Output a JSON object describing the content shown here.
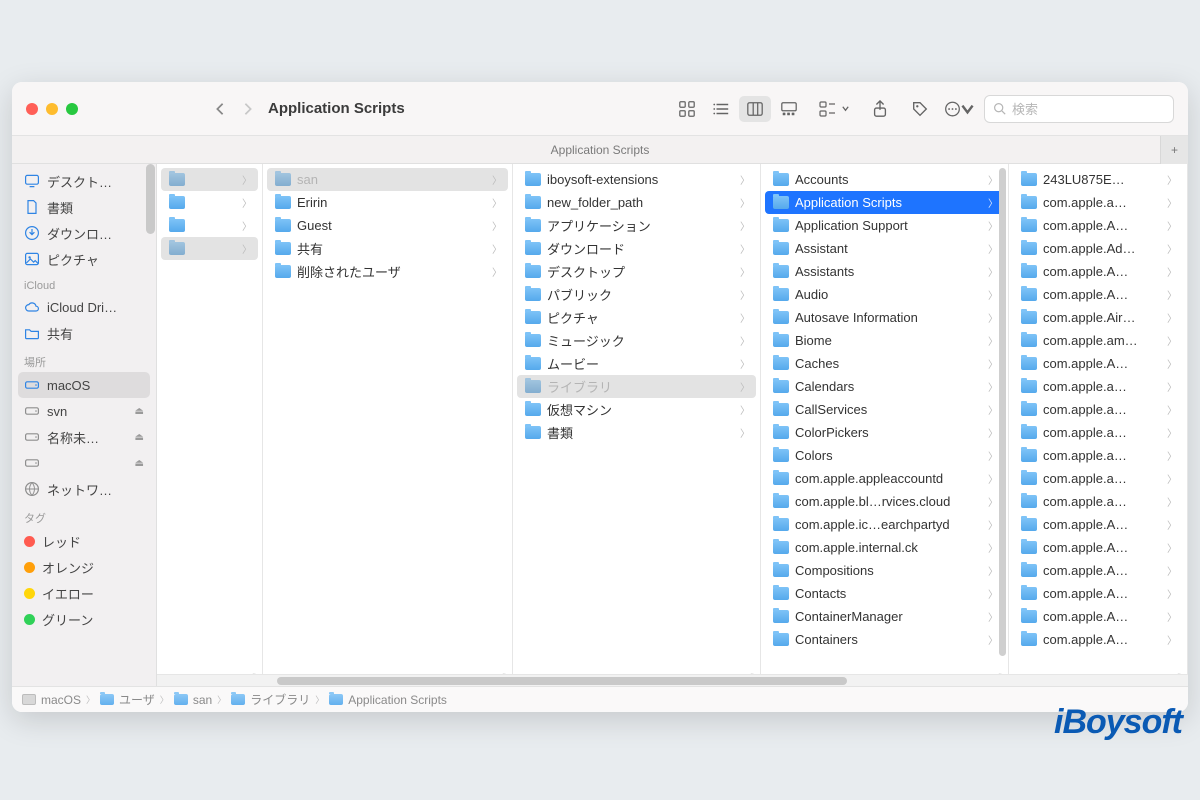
{
  "window": {
    "title": "Application Scripts",
    "tab_label": "Application Scripts"
  },
  "search": {
    "placeholder": "検索"
  },
  "sidebar": {
    "favorites": [
      {
        "icon": "desktop",
        "label": "デスクト…"
      },
      {
        "icon": "doc",
        "label": "書類"
      },
      {
        "icon": "download",
        "label": "ダウンロ…"
      },
      {
        "icon": "picture",
        "label": "ピクチャ"
      }
    ],
    "icloud_header": "iCloud",
    "icloud": [
      {
        "icon": "cloud",
        "label": "iCloud Dri…"
      },
      {
        "icon": "sharefolder",
        "label": "共有"
      }
    ],
    "locations_header": "場所",
    "locations": [
      {
        "icon": "drive",
        "label": "macOS",
        "selected": true
      },
      {
        "icon": "drive",
        "label": "svn",
        "eject": true,
        "gray": true
      },
      {
        "icon": "drive",
        "label": "名称未…",
        "eject": true,
        "gray": true
      },
      {
        "icon": "drive",
        "label": "",
        "eject": true,
        "gray": true
      },
      {
        "icon": "globe",
        "label": "ネットワ…",
        "gray": true
      }
    ],
    "tags_header": "タグ",
    "tags": [
      {
        "color": "#ff5b50",
        "label": "レッド"
      },
      {
        "color": "#ff9f0a",
        "label": "オレンジ"
      },
      {
        "color": "#ffd60a",
        "label": "イエロー"
      },
      {
        "color": "#30d158",
        "label": "グリーン"
      }
    ]
  },
  "columns": [
    {
      "items": [
        {
          "label": "",
          "sel": "gray"
        },
        {
          "label": ""
        },
        {
          "label": ""
        },
        {
          "label": "",
          "sel": "gray"
        }
      ]
    },
    {
      "items": [
        {
          "label": "san",
          "sel": "gray",
          "dim": true
        },
        {
          "label": "Eririn"
        },
        {
          "label": "Guest"
        },
        {
          "label": "共有"
        },
        {
          "label": "削除されたユーザ"
        }
      ]
    },
    {
      "items": [
        {
          "label": "iboysoft-extensions"
        },
        {
          "label": "new_folder_path"
        },
        {
          "label": "アプリケーション"
        },
        {
          "label": "ダウンロード"
        },
        {
          "label": "デスクトップ"
        },
        {
          "label": "パブリック"
        },
        {
          "label": "ピクチャ"
        },
        {
          "label": "ミュージック"
        },
        {
          "label": "ムービー"
        },
        {
          "label": "ライブラリ",
          "sel": "gray",
          "dim": true
        },
        {
          "label": "仮想マシン"
        },
        {
          "label": "書類"
        }
      ]
    },
    {
      "items": [
        {
          "label": "Accounts"
        },
        {
          "label": "Application Scripts",
          "sel": "blue"
        },
        {
          "label": "Application Support"
        },
        {
          "label": "Assistant"
        },
        {
          "label": "Assistants"
        },
        {
          "label": "Audio"
        },
        {
          "label": "Autosave Information"
        },
        {
          "label": "Biome"
        },
        {
          "label": "Caches"
        },
        {
          "label": "Calendars"
        },
        {
          "label": "CallServices"
        },
        {
          "label": "ColorPickers"
        },
        {
          "label": "Colors"
        },
        {
          "label": "com.apple.appleaccountd"
        },
        {
          "label": "com.apple.bl…rvices.cloud"
        },
        {
          "label": "com.apple.ic…earchpartyd"
        },
        {
          "label": "com.apple.internal.ck"
        },
        {
          "label": "Compositions"
        },
        {
          "label": "Contacts"
        },
        {
          "label": "ContainerManager"
        },
        {
          "label": "Containers"
        }
      ],
      "scroll": true
    },
    {
      "items": [
        {
          "label": "243LU875E…"
        },
        {
          "label": "com.apple.a…"
        },
        {
          "label": "com.apple.A…"
        },
        {
          "label": "com.apple.Ad…"
        },
        {
          "label": "com.apple.A…"
        },
        {
          "label": "com.apple.A…"
        },
        {
          "label": "com.apple.Air…"
        },
        {
          "label": "com.apple.am…"
        },
        {
          "label": "com.apple.A…"
        },
        {
          "label": "com.apple.a…"
        },
        {
          "label": "com.apple.a…"
        },
        {
          "label": "com.apple.a…"
        },
        {
          "label": "com.apple.a…"
        },
        {
          "label": "com.apple.a…"
        },
        {
          "label": "com.apple.a…"
        },
        {
          "label": "com.apple.A…"
        },
        {
          "label": "com.apple.A…"
        },
        {
          "label": "com.apple.A…"
        },
        {
          "label": "com.apple.A…"
        },
        {
          "label": "com.apple.A…"
        },
        {
          "label": "com.apple.A…"
        }
      ]
    }
  ],
  "pathbar": [
    {
      "icon": "drive",
      "label": "macOS"
    },
    {
      "icon": "folder",
      "label": "ユーザ"
    },
    {
      "icon": "folder",
      "label": "san"
    },
    {
      "icon": "folder",
      "label": "ライブラリ"
    },
    {
      "icon": "folder",
      "label": "Application Scripts"
    }
  ],
  "watermark": "iBoysoft"
}
